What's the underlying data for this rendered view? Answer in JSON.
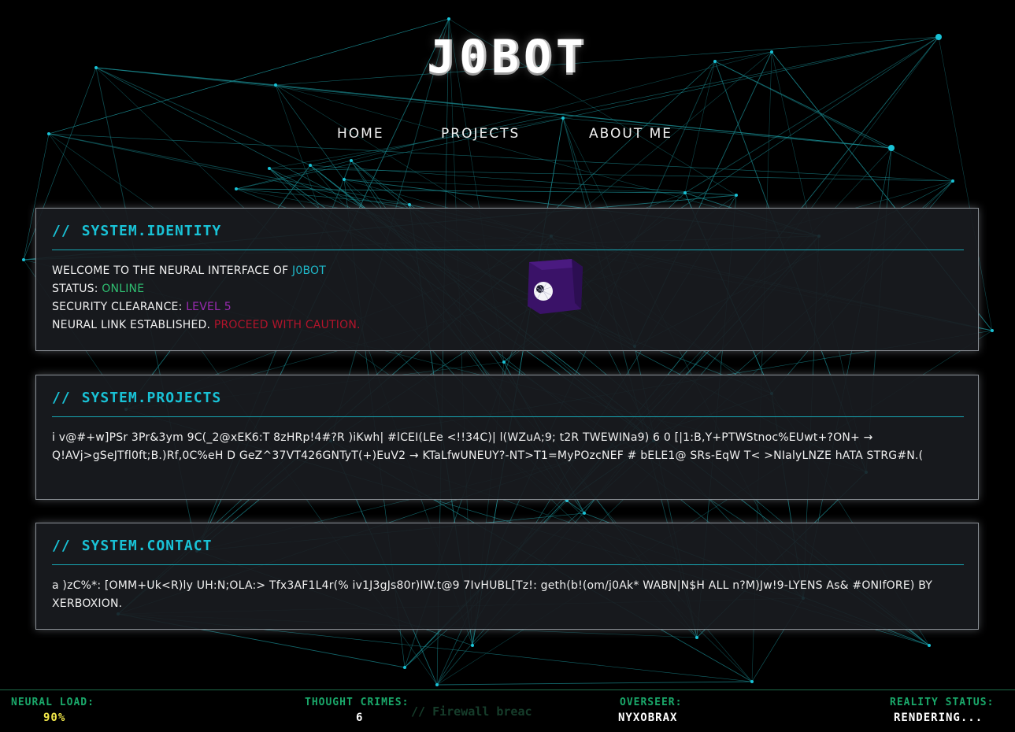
{
  "site": {
    "title": "J0BOT"
  },
  "nav": {
    "items": [
      {
        "label": "HOME"
      },
      {
        "label": "PROJECTS"
      },
      {
        "label": "ABOUT ME"
      }
    ]
  },
  "identity": {
    "header_prefix": "//",
    "header_title": "SYSTEM.IDENTITY",
    "welcome_text": "WELCOME TO THE NEURAL INTERFACE OF ",
    "welcome_name": "J0BOT",
    "status_label": "STATUS: ",
    "status_value": "ONLINE",
    "clearance_label": "SECURITY CLEARANCE: ",
    "clearance_value": "LEVEL 5",
    "link_label": "NEURAL LINK ESTABLISHED. ",
    "link_warning": "PROCEED WITH CAUTION."
  },
  "projects": {
    "header_prefix": "//",
    "header_title": "SYSTEM.PROJECTS",
    "body": "i v@#+w]PSr 3Pr&3ym 9C(_2@xEK6:T 8zHRp!4#?R )iKwh| #lCEI(LEe <!!34C)| l(WZuA;9; t2R TWEWINa9) 6 0 [|1:B,Y+PTWStnoc%EUwt+?ON+ → Q!AVj>gSeJTfl0ft;B.)Rf,0C%eH D GeZ^37VT426GNTyT(+)EuV2 → KTaLfwUNEUY?-NT>T1=MyPOzcNEF # bELE1@ SRs-EqW T< >NIalyLNZE hATA STRG#N.("
  },
  "contact": {
    "header_prefix": "//",
    "header_title": "SYSTEM.CONTACT",
    "body": "a )zC%*: [OMM+Uk<R)ly UH:N;OLA:> Tfx3AF1L4r(% iv1J3gJs80r)IW.t@9 7IvHUBL[Tz!: geth(b!(om/j0Ak* WABN|N$H ALL n?M)Jw!9-LYENS As& #ONIfORE) BY XERBOXION."
  },
  "status_bar": {
    "neural_load_label": "NEURAL LOAD:",
    "neural_load_value": "90%",
    "thought_crimes_label": "THOUGHT CRIMES:",
    "thought_crimes_value": "6",
    "ghost_text": "// Firewall breac",
    "overseer_label": "OVERSEER:",
    "overseer_value": "NYXOBRAX",
    "reality_label": "REALITY STATUS:",
    "reality_value": "RENDERING..."
  },
  "colors": {
    "accent_cyan": "#19c2d6",
    "status_green": "#2fbf71",
    "clearance_purple": "#9a2ab0",
    "warning_red": "#b3142b",
    "load_yellow": "#f2e84a",
    "network_line": "#1a8a90"
  },
  "icons": {
    "cube": "purple-cube-icon"
  }
}
